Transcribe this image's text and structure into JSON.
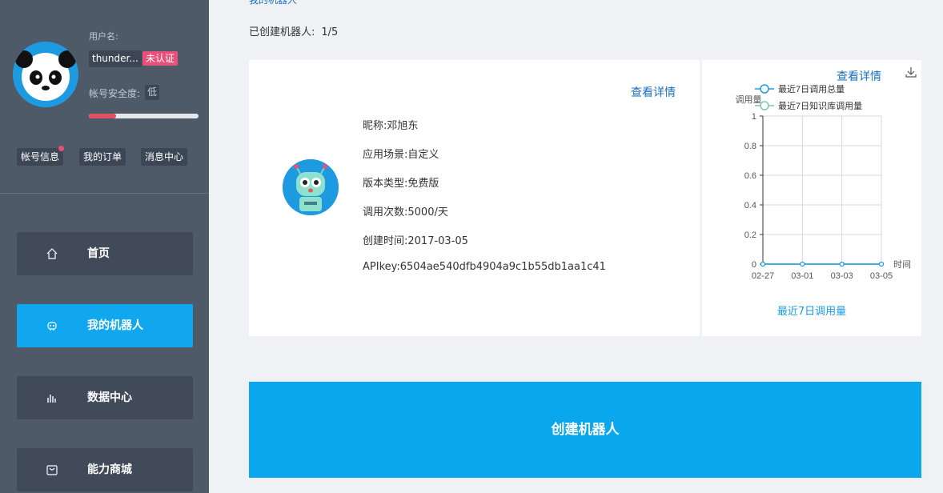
{
  "sidebar": {
    "user_label": "用户名:",
    "username": "thunder...",
    "unverified_badge": "未认证",
    "security_label": "帐号安全度:",
    "security_level": "低",
    "security_progress": 0.25,
    "links": [
      "帐号信息",
      "我的订单",
      "消息中心"
    ],
    "nav": [
      {
        "label": "首页",
        "icon": "home-icon",
        "active": false
      },
      {
        "label": "我的机器人",
        "icon": "robot-icon",
        "active": true
      },
      {
        "label": "数据中心",
        "icon": "bar-chart-icon",
        "active": false
      },
      {
        "label": "能力商城",
        "icon": "shop-icon",
        "active": false
      }
    ]
  },
  "main": {
    "section_title": "我的机器人",
    "robot_count_label": "已创建机器人:",
    "robot_count": "1/5",
    "robot_card": {
      "detail_link": "查看详情",
      "fields": [
        "昵称:邓旭东",
        "应用场景:自定义",
        "版本类型:免费版",
        "调用次数:5000/天",
        "创建时间:2017-03-05",
        "APIkey:6504ae540dfb4904a9c1b55db1aa1c41"
      ]
    },
    "chart_card": {
      "detail_link": "查看详情",
      "caption": "最近7日调用量"
    },
    "create_button": "创建机器人"
  },
  "colors": {
    "sidebar_bg": "#4f5a69",
    "accent": "#0aa7ef",
    "link": "#1a6fbf",
    "badge": "#e8507b",
    "series_total": "#1e9be0",
    "series_kb": "#7dc7a8"
  },
  "chart_data": {
    "type": "line",
    "ylabel": "调用量",
    "xlabel": "时间",
    "x": [
      "02-27",
      "03-01",
      "03-03",
      "03-05"
    ],
    "ylim": [
      0,
      1
    ],
    "yticks": [
      "0",
      "0.2",
      "0.4",
      "0.6",
      "0.8",
      "1"
    ],
    "grid": true,
    "legend": "top",
    "series": [
      {
        "name": "最近7日调用总量",
        "values": [
          0,
          0,
          0,
          0
        ],
        "color": "#1e9be0"
      },
      {
        "name": "最近7日知识库调用量",
        "values": [
          0,
          0,
          0,
          0
        ],
        "color": "#7dc7a8"
      }
    ]
  }
}
